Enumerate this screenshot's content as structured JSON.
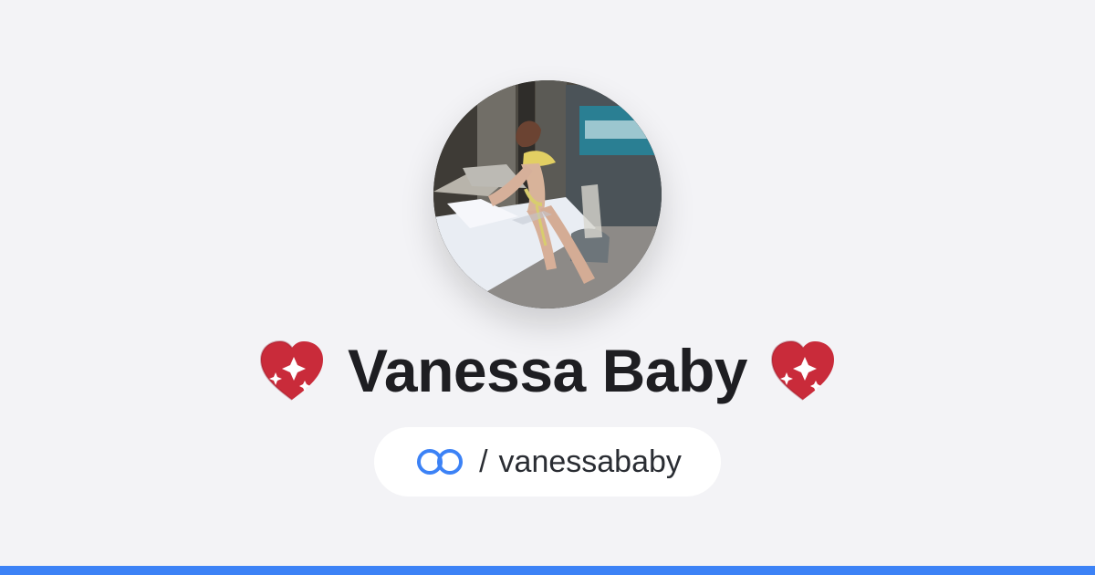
{
  "profile": {
    "display_name": "Vanessa Baby",
    "username_prefix": "/",
    "username": "vanessababy"
  },
  "icons": {
    "left_heart": "sparkling-heart-icon",
    "right_heart": "sparkling-heart-icon",
    "link": "link-icon"
  },
  "colors": {
    "background": "#f3f3f6",
    "name_text": "#1e1e22",
    "username_text": "#2a2d33",
    "pill_background": "#ffffff",
    "link_icon": "#3c82f6",
    "bottom_bar": "#3c82f6",
    "heart": "#c92b3a"
  }
}
